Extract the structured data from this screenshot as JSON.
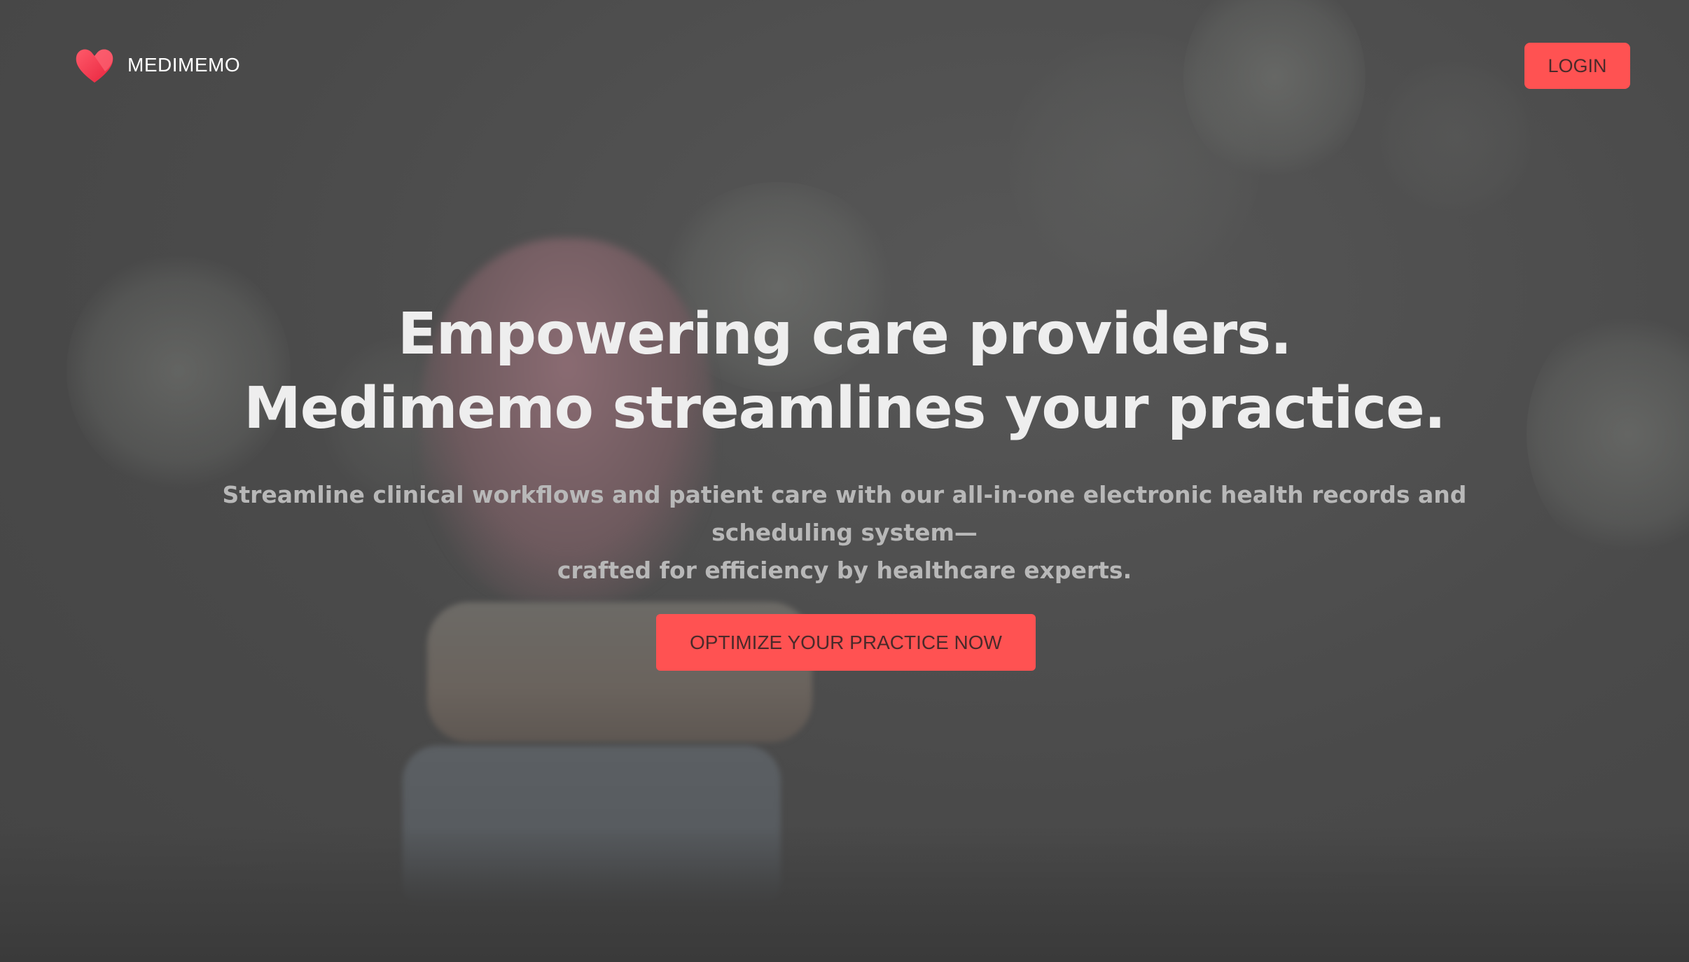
{
  "header": {
    "brand_name": "MEDIMEMO",
    "login_label": "LOGIN"
  },
  "hero": {
    "headline_line1": "Empowering care providers.",
    "headline_line2": "Medimemo streamlines your practice.",
    "subtext_line1": "Streamline clinical workflows and patient care with our all-in-one electronic health records and scheduling system—",
    "subtext_line2": "crafted for efficiency by healthcare experts.",
    "cta_label": "OPTIMIZE YOUR PRACTICE NOW",
    "background_image": "blurred-marshmallow-heart-stack"
  },
  "icons": {
    "logo": "heart-icon"
  },
  "colors": {
    "accent": "#ff5252",
    "overlay": "#4a4a4a",
    "headline": "#eeeeee",
    "subtext": "#b8b8b8"
  }
}
